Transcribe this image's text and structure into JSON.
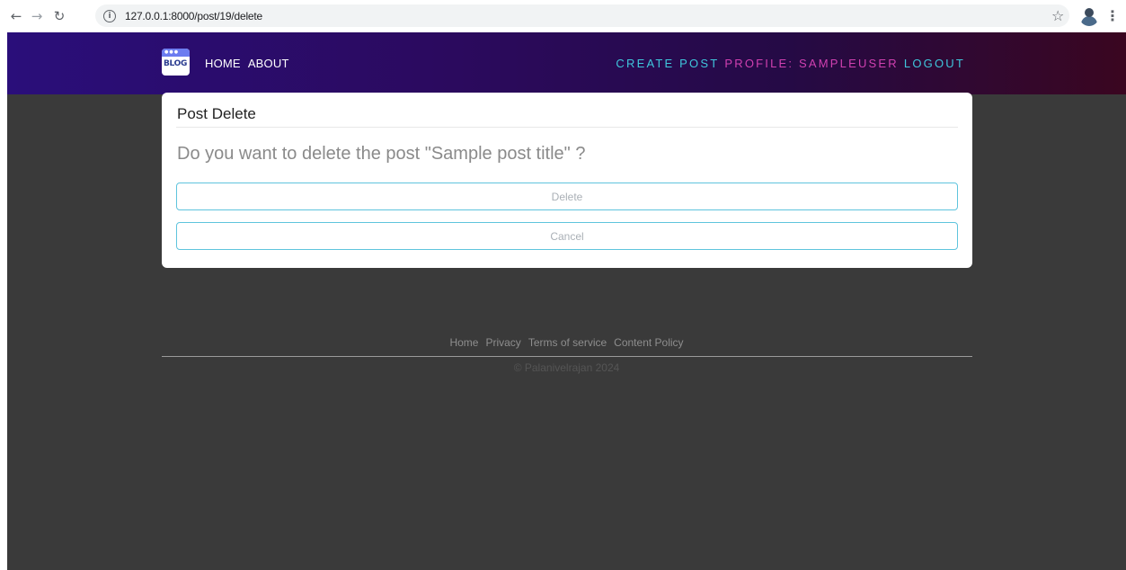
{
  "browser": {
    "url": "127.0.0.1:8000/post/19/delete"
  },
  "navbar": {
    "brand_text": "BLOG",
    "left_links": [
      "HOME",
      "ABOUT"
    ],
    "right_links": [
      {
        "label": "CREATE POST",
        "color": "#3fc6dc"
      },
      {
        "label": "PROFILE: SAMPLEUSER",
        "color": "#d040b0"
      },
      {
        "label": "LOGOUT",
        "color": "#3fc6dc"
      }
    ],
    "gradient_colors": [
      "#2a0e7a",
      "#3a0620"
    ]
  },
  "card": {
    "title": "Post Delete",
    "question": "Do you want to delete the post \"Sample post title\" ?",
    "delete_label": "Delete",
    "cancel_label": "Cancel",
    "button_border_color": "#5fc4dd"
  },
  "footer": {
    "links": [
      "Home",
      "Privacy",
      "Terms of service",
      "Content Policy"
    ],
    "copyright": "© Palanivelrajan 2024"
  },
  "colors": {
    "page_background": "#3a3a3a"
  }
}
